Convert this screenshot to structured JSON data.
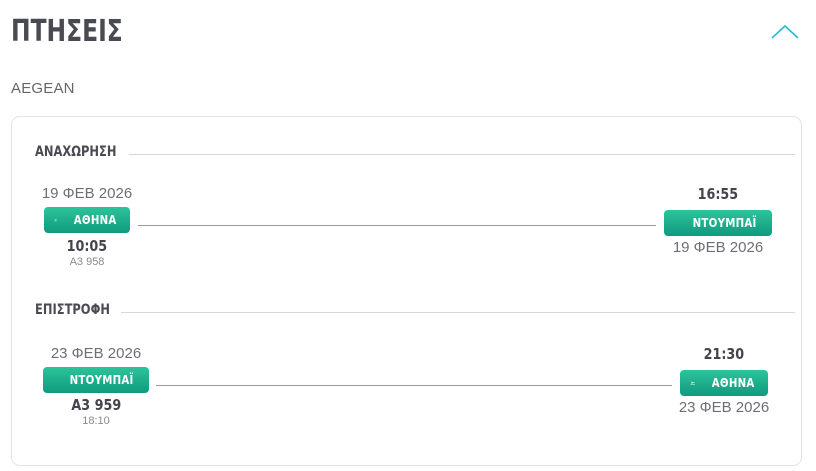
{
  "header": {
    "title": "ΠΤΗΣΕΙΣ",
    "collapse_icon": "chevron-up-icon",
    "accent_color": "#2bb8d9"
  },
  "airline": "AEGEAN",
  "pill_gradient": [
    "#2cc49a",
    "#109a7e"
  ],
  "outbound": {
    "label": "ΑΝΑΧΩΡΗΣΗ",
    "departure": {
      "date": "19 ΦΕΒ 2026",
      "city": "ΑΘΗΝΑ",
      "time": "10:05",
      "flight": "A3 958",
      "icon": "plane-departure-icon"
    },
    "arrival": {
      "time": "16:55",
      "city": "ΝΤΟΥΜΠΑΪ",
      "date": "19 ΦΕΒ 2026",
      "icon": "plane-departure-icon"
    }
  },
  "return": {
    "label": "ΕΠΙΣΤΡΟΦΗ",
    "departure": {
      "date": "23 ΦΕΒ 2026",
      "city": "ΝΤΟΥΜΠΑΪ",
      "flight": "A3 959",
      "time": "18:10",
      "icon": "plane-departure-icon"
    },
    "arrival": {
      "time": "21:30",
      "city": "ΑΘΗΝΑ",
      "date": "23 ΦΕΒ 2026",
      "icon": "plane-departure-icon"
    }
  }
}
